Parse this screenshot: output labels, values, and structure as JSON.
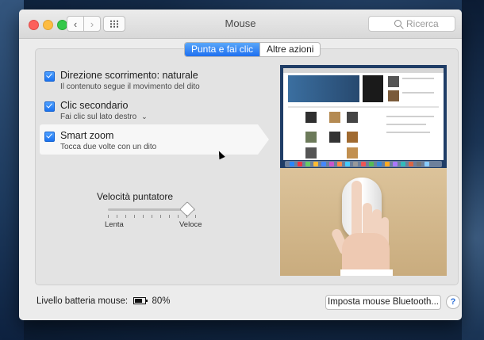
{
  "window": {
    "title": "Mouse",
    "search_placeholder": "Ricerca"
  },
  "tabs": [
    {
      "label": "Punta e fai clic",
      "active": true
    },
    {
      "label": "Altre azioni",
      "active": false
    }
  ],
  "options": [
    {
      "title": "Direzione scorrimento: naturale",
      "subtitle": "Il contenuto segue il movimento del dito",
      "checked": true
    },
    {
      "title": "Clic secondario",
      "subtitle": "Fai clic sul lato destro",
      "checked": true
    },
    {
      "title": "Smart zoom",
      "subtitle": "Tocca due volte con un dito",
      "checked": true
    }
  ],
  "tracking": {
    "label": "Velocità puntatore",
    "min_label": "Lenta",
    "max_label": "Veloce",
    "value_fraction": 0.9
  },
  "footer": {
    "battery_label": "Livello batteria mouse:",
    "battery_percent": "80%",
    "bluetooth_button": "Imposta mouse Bluetooth...",
    "help_label": "?"
  },
  "icons": {
    "back": "chevron-left-icon",
    "forward": "chevron-right-icon",
    "grid": "grid-icon",
    "search": "search-icon",
    "checkbox": "checkmark-icon",
    "battery": "battery-icon"
  },
  "colors": {
    "accent": "#1e6ff0",
    "close": "#fc605c",
    "minimize": "#fdbc40",
    "zoom": "#34c84a"
  }
}
